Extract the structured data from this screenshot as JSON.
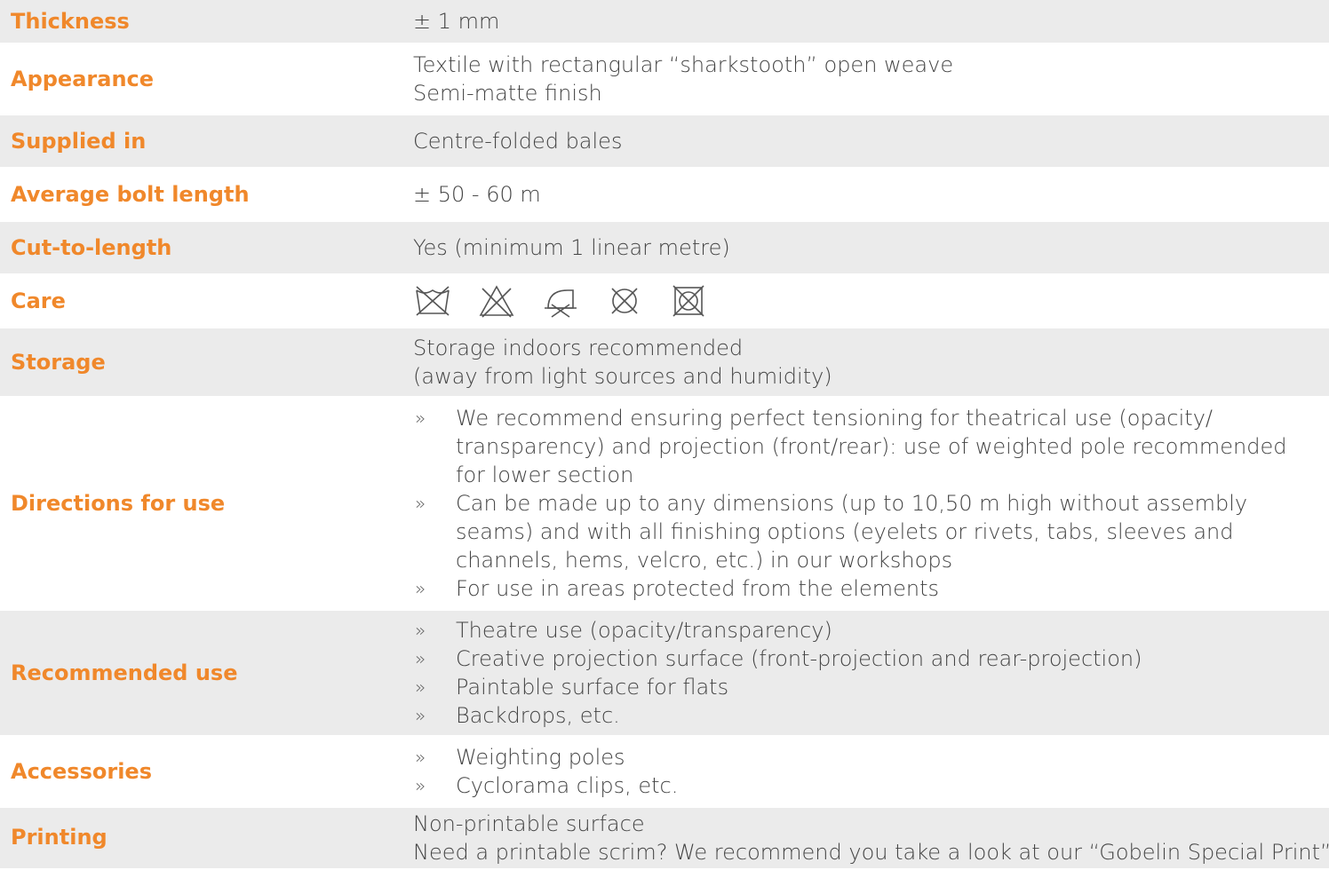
{
  "spec": {
    "thickness": {
      "label": "Thickness",
      "value": "± 1 mm"
    },
    "appearance": {
      "label": "Appearance",
      "lines": [
        "Textile with rectangular “sharkstooth” open weave",
        "Semi-matte finish"
      ]
    },
    "supplied": {
      "label": "Supplied in",
      "value": "Centre-folded bales"
    },
    "bolt": {
      "label": "Average bolt length",
      "value": "± 50 - 60 m"
    },
    "cut": {
      "label": "Cut-to-length",
      "value": "Yes (minimum 1 linear metre)"
    },
    "care": {
      "label": "Care",
      "icons": [
        "no-wash-icon",
        "no-bleach-icon",
        "no-iron-icon",
        "no-dry-clean-icon",
        "no-tumble-dry-icon"
      ]
    },
    "storage": {
      "label": "Storage",
      "lines": [
        "Storage indoors recommended",
        "(away from light sources and humidity)"
      ]
    },
    "directions": {
      "label": "Directions for use",
      "bullet": "»",
      "items": [
        [
          "We recommend ensuring perfect tensioning for theatrical use (opacity/",
          "transparency) and projection (front/rear): use of weighted pole recommended",
          "for lower section"
        ],
        [
          "Can be made up to any dimensions (up to 10,50 m high without assembly",
          "seams) and with all finishing options (eyelets or rivets, tabs, sleeves and",
          "channels, hems, velcro, etc.) in our workshops"
        ],
        [
          "For use in areas protected from the elements"
        ]
      ]
    },
    "recommended": {
      "label": "Recommended use",
      "items": [
        "Theatre use (opacity/transparency)",
        "Creative projection surface (front-projection and rear-projection)",
        "Paintable surface for flats",
        "Backdrops, etc."
      ]
    },
    "accessories": {
      "label": "Accessories",
      "items": [
        "Weighting poles",
        "Cyclorama clips, etc."
      ]
    },
    "printing": {
      "label": "Printing",
      "lines": [
        "Non-printable surface",
        "Need a printable scrim? We recommend you take a look at our “Gobelin Special Print”"
      ]
    }
  },
  "colors": {
    "label": "#f0882b",
    "text": "#444444",
    "shade": "#ebebeb"
  }
}
